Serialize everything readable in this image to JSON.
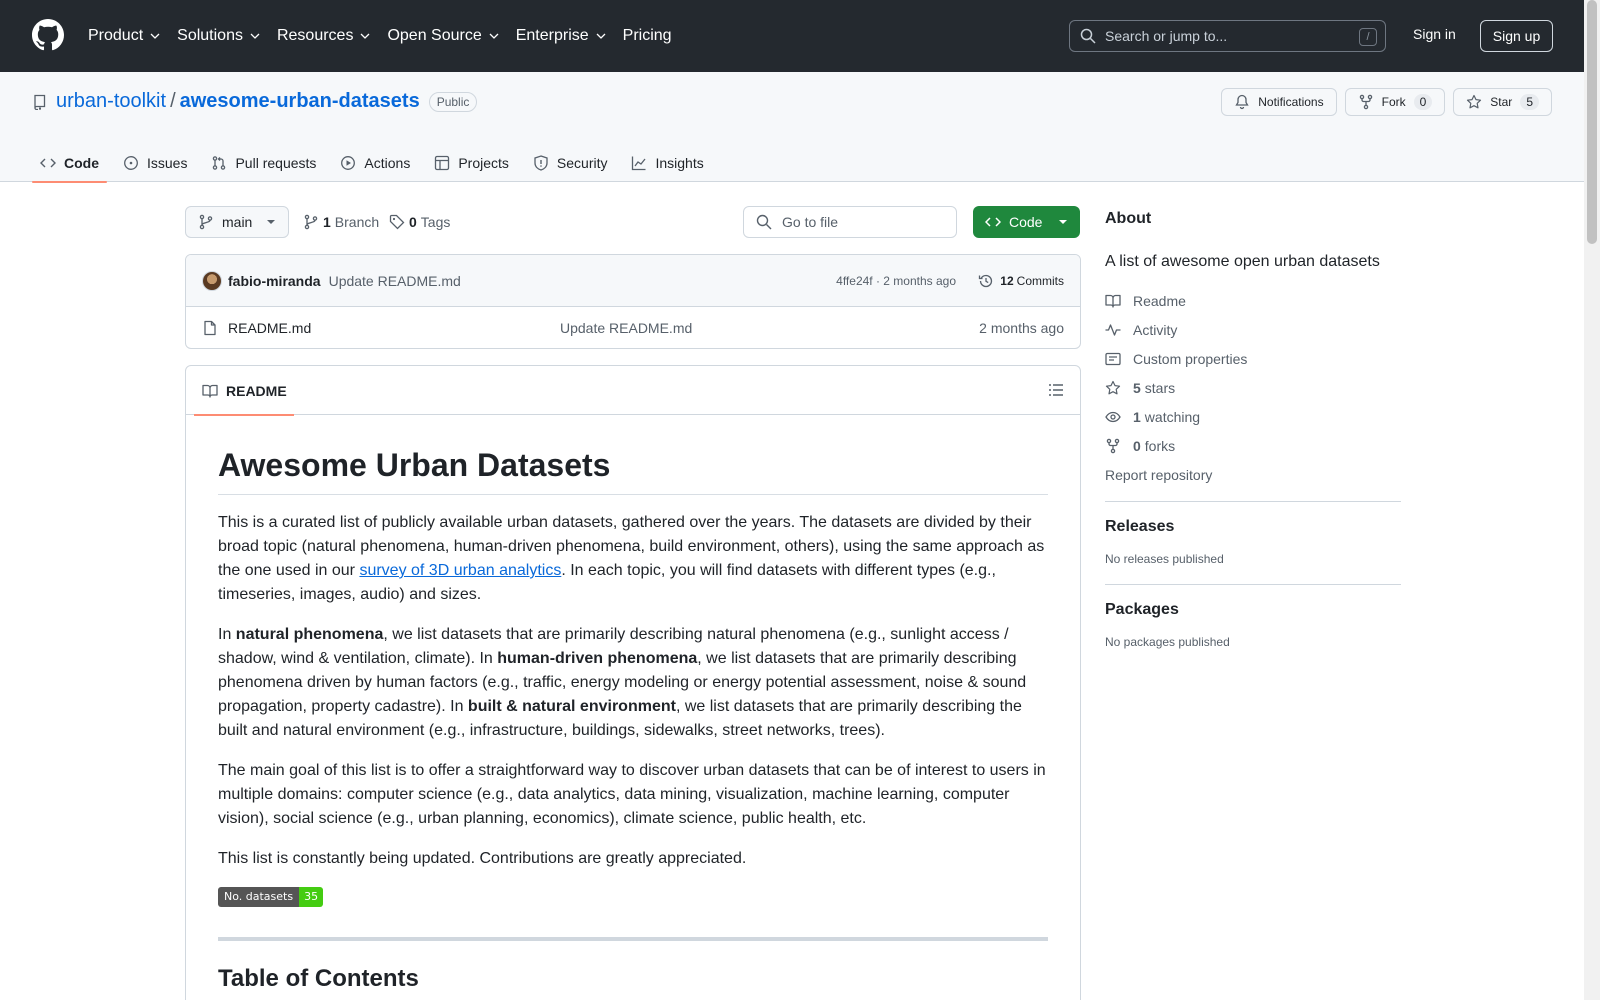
{
  "header": {
    "nav": [
      {
        "label": "Product",
        "has_menu": true
      },
      {
        "label": "Solutions",
        "has_menu": true
      },
      {
        "label": "Resources",
        "has_menu": true
      },
      {
        "label": "Open Source",
        "has_menu": true
      },
      {
        "label": "Enterprise",
        "has_menu": true
      },
      {
        "label": "Pricing",
        "has_menu": false
      }
    ],
    "search_placeholder": "Search or jump to...",
    "search_shortcut": "/",
    "sign_in": "Sign in",
    "sign_up": "Sign up"
  },
  "repo": {
    "owner": "urban-toolkit",
    "separator": "/",
    "name": "awesome-urban-datasets",
    "visibility": "Public",
    "actions": {
      "notifications": "Notifications",
      "fork": "Fork",
      "fork_count": "0",
      "star": "Star",
      "star_count": "5"
    },
    "tabs": [
      {
        "label": "Code",
        "icon": "code-icon",
        "active": true
      },
      {
        "label": "Issues",
        "icon": "issue-icon",
        "active": false
      },
      {
        "label": "Pull requests",
        "icon": "pull-request-icon",
        "active": false
      },
      {
        "label": "Actions",
        "icon": "play-icon",
        "active": false
      },
      {
        "label": "Projects",
        "icon": "table-icon",
        "active": false
      },
      {
        "label": "Security",
        "icon": "shield-icon",
        "active": false
      },
      {
        "label": "Insights",
        "icon": "graph-icon",
        "active": false
      }
    ]
  },
  "toolbar": {
    "branch": "main",
    "branch_count": "1",
    "branch_label": "Branch",
    "tag_count": "0",
    "tag_label": "Tags",
    "go_to_file": "Go to file",
    "code_button": "Code"
  },
  "latest_commit": {
    "author": "fabio-miranda",
    "message": "Update README.md",
    "sha_time": "4ffe24f · 2 months ago",
    "count": "12",
    "count_label": "Commits"
  },
  "files": [
    {
      "name": "README.md",
      "message": "Update README.md",
      "date": "2 months ago"
    }
  ],
  "readme": {
    "tab_label": "README",
    "title": "Awesome Urban Datasets",
    "p1_before": "This is a curated list of publicly available urban datasets, gathered over the years. The datasets are divided by their broad topic (natural phenomena, human-driven phenomena, build environment, others), using the same approach as the one used in our ",
    "p1_link": "survey of 3D urban analytics",
    "p1_after": ". In each topic, you will find datasets with different types (e.g., timeseries, images, audio) and sizes.",
    "p2_a": "In ",
    "p2_b": "natural phenomena",
    "p2_c": ", we list datasets that are primarily describing natural phenomena (e.g., sunlight access / shadow, wind & ventilation, climate). In ",
    "p2_d": "human-driven phenomena",
    "p2_e": ", we list datasets that are primarily describing phenomena driven by human factors (e.g., traffic, energy modeling or energy potential assessment, noise & sound propagation, property cadastre). In ",
    "p2_f": "built & natural environment",
    "p2_g": ", we list datasets that are primarily describing the built and natural environment (e.g., infrastructure, buildings, sidewalks, street networks, trees).",
    "p3": "The main goal of this list is to offer a straightforward way to discover urban datasets that can be of interest to users in multiple domains: computer science (e.g., data analytics, data mining, visualization, machine learning, computer vision), social science (e.g., urban planning, economics), climate science, public health, etc.",
    "p4": "This list is constantly being updated. Contributions are greatly appreciated.",
    "badge_label": "No. datasets",
    "badge_value": "35",
    "toc_title": "Table of Contents"
  },
  "about": {
    "heading": "About",
    "description": "A list of awesome open urban datasets",
    "links": {
      "readme": "Readme",
      "activity": "Activity",
      "custom_properties": "Custom properties",
      "stars_count": "5",
      "stars_label": "stars",
      "watching_count": "1",
      "watching_label": "watching",
      "forks_count": "0",
      "forks_label": "forks",
      "report": "Report repository"
    },
    "releases_heading": "Releases",
    "releases_text": "No releases published",
    "packages_heading": "Packages",
    "packages_text": "No packages published"
  },
  "colors": {
    "header_bg": "#24292f",
    "link": "#0969da",
    "primary_button": "#1f883d",
    "active_tab_underline": "#fd8c73",
    "badge_value_bg": "#44cc11"
  }
}
